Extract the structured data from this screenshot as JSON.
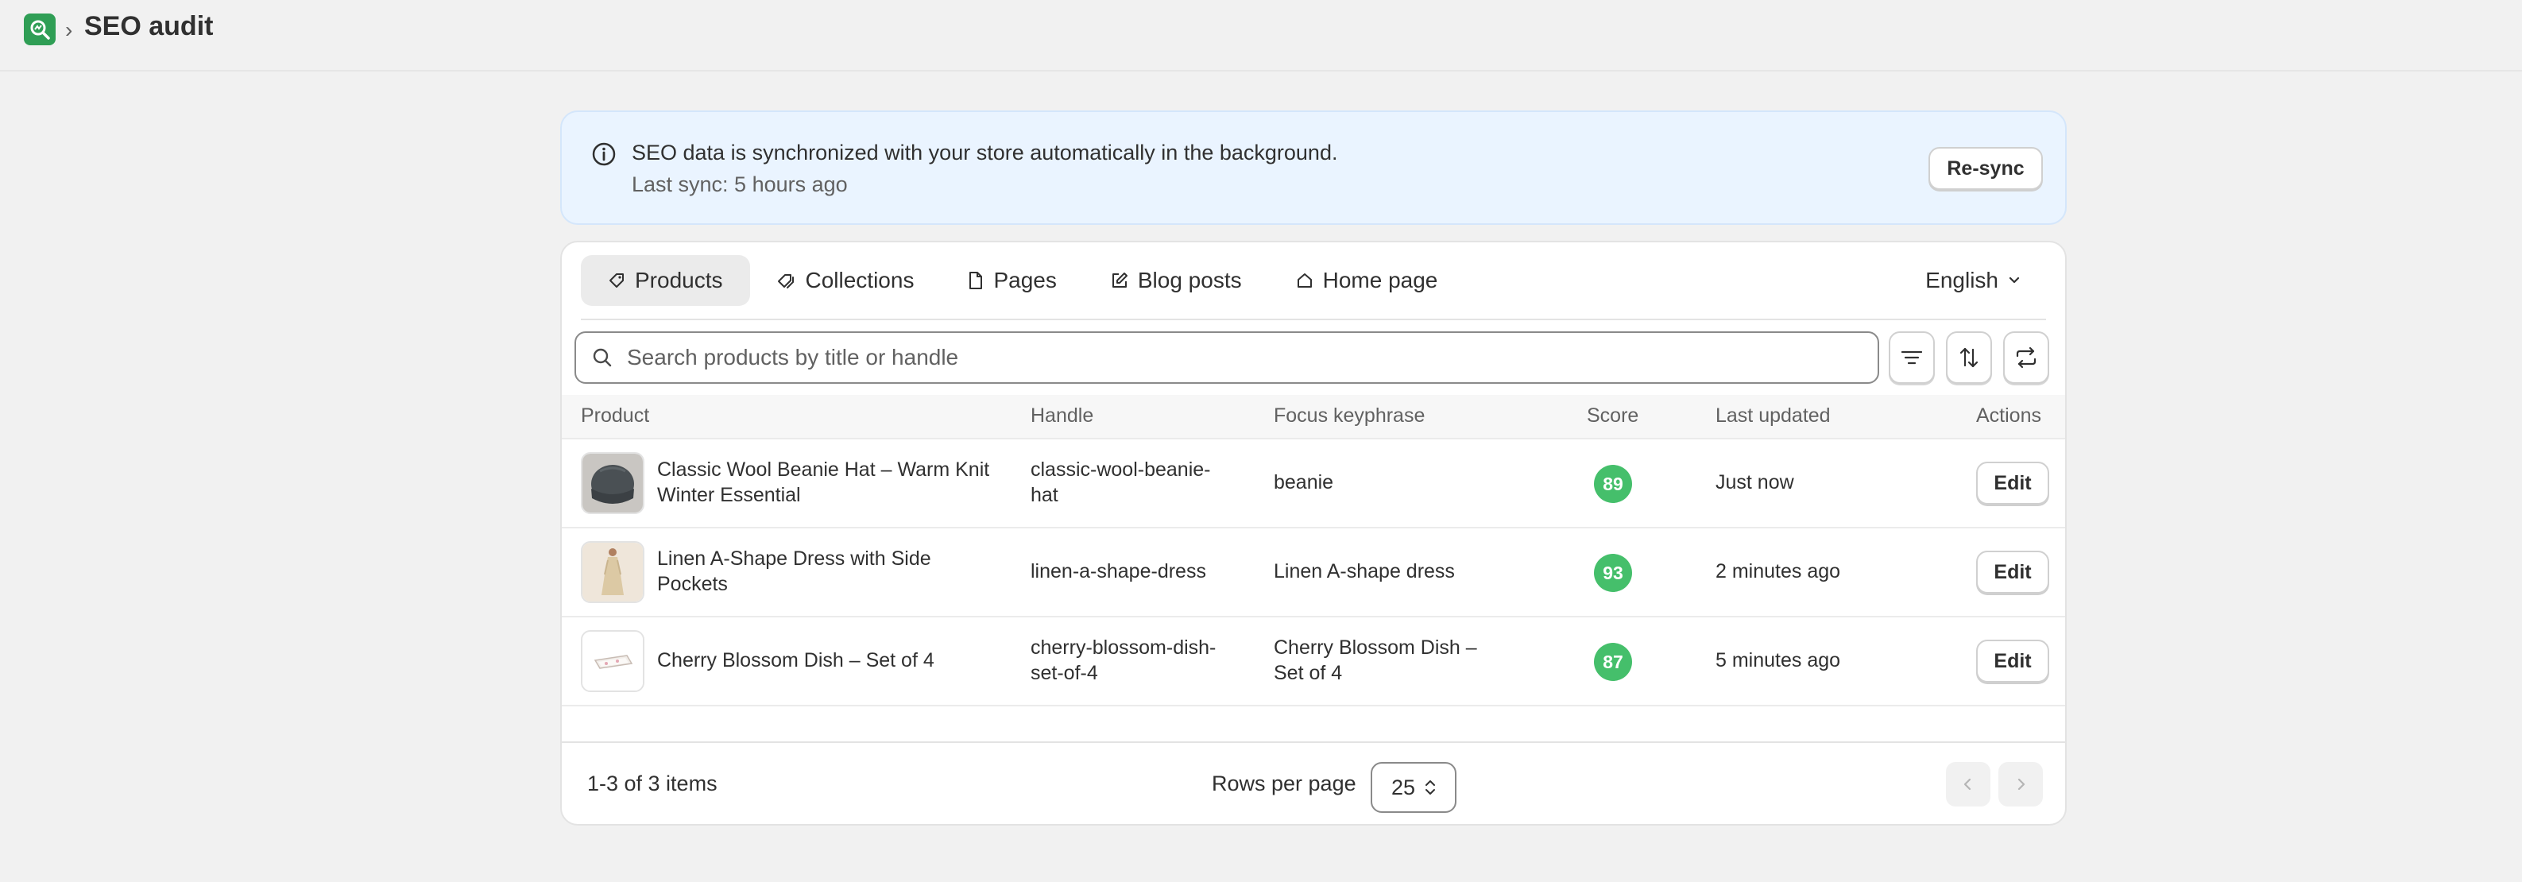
{
  "header": {
    "title": "SEO audit",
    "separator": "›",
    "logo_icon": "magnifier-chart-icon"
  },
  "banner": {
    "message": "SEO data is synchronized with your store automatically in the background.",
    "last_sync": "Last sync: 5 hours ago",
    "resync_label": "Re-sync",
    "icon": "info-icon"
  },
  "tabs": [
    {
      "label": "Products",
      "icon": "tag-icon",
      "active": true
    },
    {
      "label": "Collections",
      "icon": "collection-tag-icon",
      "active": false
    },
    {
      "label": "Pages",
      "icon": "page-icon",
      "active": false
    },
    {
      "label": "Blog posts",
      "icon": "edit-note-icon",
      "active": false
    },
    {
      "label": "Home page",
      "icon": "home-icon",
      "active": false
    }
  ],
  "language": {
    "selected": "English"
  },
  "search": {
    "placeholder": "Search products by title or handle",
    "value": ""
  },
  "table": {
    "columns": {
      "product": "Product",
      "handle": "Handle",
      "focus": "Focus keyphrase",
      "score": "Score",
      "updated": "Last updated",
      "actions": "Actions"
    },
    "rows": [
      {
        "product_line1": "Classic Wool Beanie Hat – Warm Knit",
        "product_line2": "Winter Essential",
        "handle_line1": "classic-wool-beanie-",
        "handle_line2": "hat",
        "focus_line1": "beanie",
        "focus_line2": "",
        "score": "89",
        "updated": "Just now",
        "edit_label": "Edit"
      },
      {
        "product_line1": "Linen A-Shape Dress with Side",
        "product_line2": "Pockets",
        "handle_line1": "linen-a-shape-dress",
        "handle_line2": "",
        "focus_line1": "Linen A-shape dress",
        "focus_line2": "",
        "score": "93",
        "updated": "2 minutes ago",
        "edit_label": "Edit"
      },
      {
        "product_line1": "Cherry Blossom Dish – Set of 4",
        "product_line2": "",
        "handle_line1": "cherry-blossom-dish-",
        "handle_line2": "set-of-4",
        "focus_line1": "Cherry Blossom Dish –",
        "focus_line2": "Set of 4",
        "score": "87",
        "updated": "5 minutes ago",
        "edit_label": "Edit"
      }
    ]
  },
  "footer": {
    "items_count": "1-3 of 3 items",
    "rows_per_page_label": "Rows per page",
    "rows_per_page_value": "25"
  },
  "colors": {
    "score_good": "#45bf6b",
    "banner_bg": "#eaf4ff",
    "logo": "#2f9e55"
  }
}
